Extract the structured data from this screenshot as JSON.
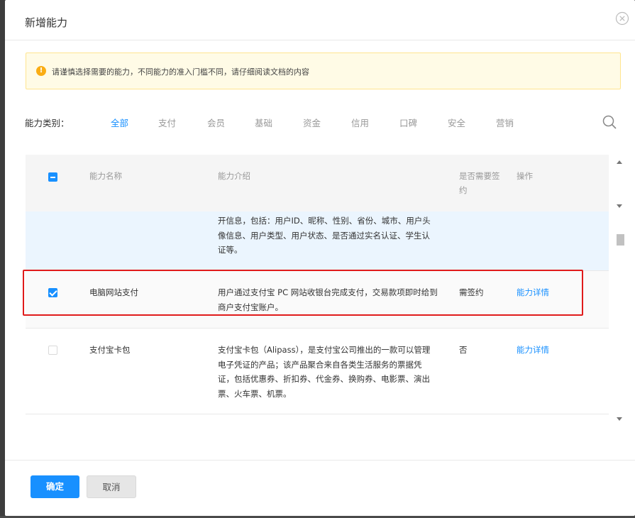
{
  "modal": {
    "title": "新增能力"
  },
  "alert": {
    "text": "请谨慎选择需要的能力，不同能力的准入门槛不同，请仔细阅读文档的内容"
  },
  "filter": {
    "label": "能力类别：",
    "tabs": [
      {
        "label": "全部",
        "active": true
      },
      {
        "label": "支付"
      },
      {
        "label": "会员"
      },
      {
        "label": "基础"
      },
      {
        "label": "资金"
      },
      {
        "label": "信用"
      },
      {
        "label": "口碑"
      },
      {
        "label": "安全"
      },
      {
        "label": "营销"
      }
    ]
  },
  "table": {
    "headers": {
      "name": "能力名称",
      "desc": "能力介绍",
      "sign": "是否需要签约",
      "action": "操作"
    },
    "rows": [
      {
        "name": "",
        "desc": "开信息，包括：用户ID、昵称、性别、省份、城市、用户头像信息、用户类型、用户状态、是否通过实名认证、学生认证等。",
        "sign": "",
        "action": ""
      },
      {
        "checked": true,
        "name": "电脑网站支付",
        "desc": "用户通过支付宝 PC 网站收银台完成支付，交易款项即时给到商户支付宝账户。",
        "sign": "需签约",
        "action": "能力详情"
      },
      {
        "checked": false,
        "name": "支付宝卡包",
        "desc": "支付宝卡包（Alipass），是支付宝公司推出的一款可以管理电子凭证的产品；该产品聚合来自各类生活服务的票据凭证，包括优惠券、折扣券、代金券、换购券、电影票、演出票、火车票、机票。",
        "sign": "否",
        "action": "能力详情"
      }
    ]
  },
  "footer": {
    "confirm": "确定",
    "cancel": "取消"
  },
  "colors": {
    "primary": "#1890ff",
    "highlight": "#e01b1b",
    "alert_bg": "#fffbe6",
    "alert_icon": "#faad14"
  }
}
